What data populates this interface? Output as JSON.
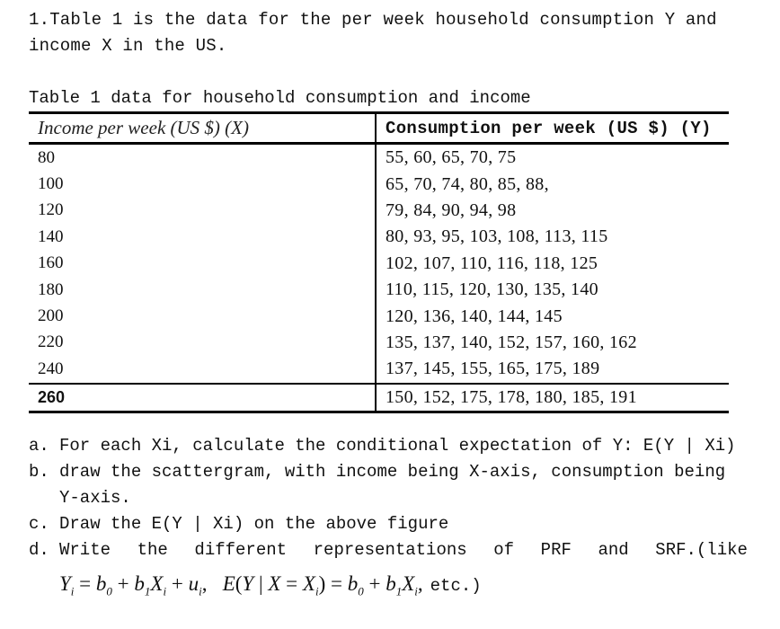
{
  "intro": {
    "line1": "1.Table 1 is the data for the per week household consumption Y and",
    "line2": "income X in the US."
  },
  "table": {
    "caption": "Table 1 data for household consumption and income",
    "headers": {
      "income": "Income per week (US $) (X)",
      "consumption": "Consumption per week (US $) (Y)"
    },
    "rows": [
      {
        "income": "80",
        "consumption": "55, 60, 65, 70, 75"
      },
      {
        "income": "100",
        "consumption": "65, 70, 74, 80, 85, 88,"
      },
      {
        "income": "120",
        "consumption": "79, 84, 90, 94, 98"
      },
      {
        "income": "140",
        "consumption": "80, 93, 95, 103, 108, 113, 115"
      },
      {
        "income": "160",
        "consumption": "102, 107, 110, 116, 118, 125"
      },
      {
        "income": "180",
        "consumption": "110, 115, 120, 130, 135, 140"
      },
      {
        "income": "200",
        "consumption": "120, 136, 140, 144, 145"
      },
      {
        "income": "220",
        "consumption": "135, 137, 140, 152, 157, 160, 162"
      },
      {
        "income": "240",
        "consumption": "137, 145, 155, 165, 175, 189"
      },
      {
        "income": "260",
        "consumption": "150, 152, 175, 178, 180, 185, 191"
      }
    ]
  },
  "questions": {
    "a": {
      "label": "a.",
      "text": "For each Xi, calculate the conditional expectation of Y: E(Y | Xi)"
    },
    "b": {
      "label": "b.",
      "text": "draw the scattergram, with income being X-axis, consumption being",
      "text2": "Y-axis."
    },
    "c": {
      "label": "c.",
      "text": "Draw the E(Y | Xi) on the above figure"
    },
    "d": {
      "label": "d.",
      "words": [
        "Write",
        "the",
        "different",
        "representations",
        "of",
        "PRF",
        "and",
        "SRF.(like"
      ]
    },
    "formula": {
      "prf_stochastic": "Yi = b0 + b1Xi + ui,",
      "prf_conditional": "E(Y | X = Xi) = b0 + b1Xi,",
      "suffix": "etc.)"
    }
  }
}
